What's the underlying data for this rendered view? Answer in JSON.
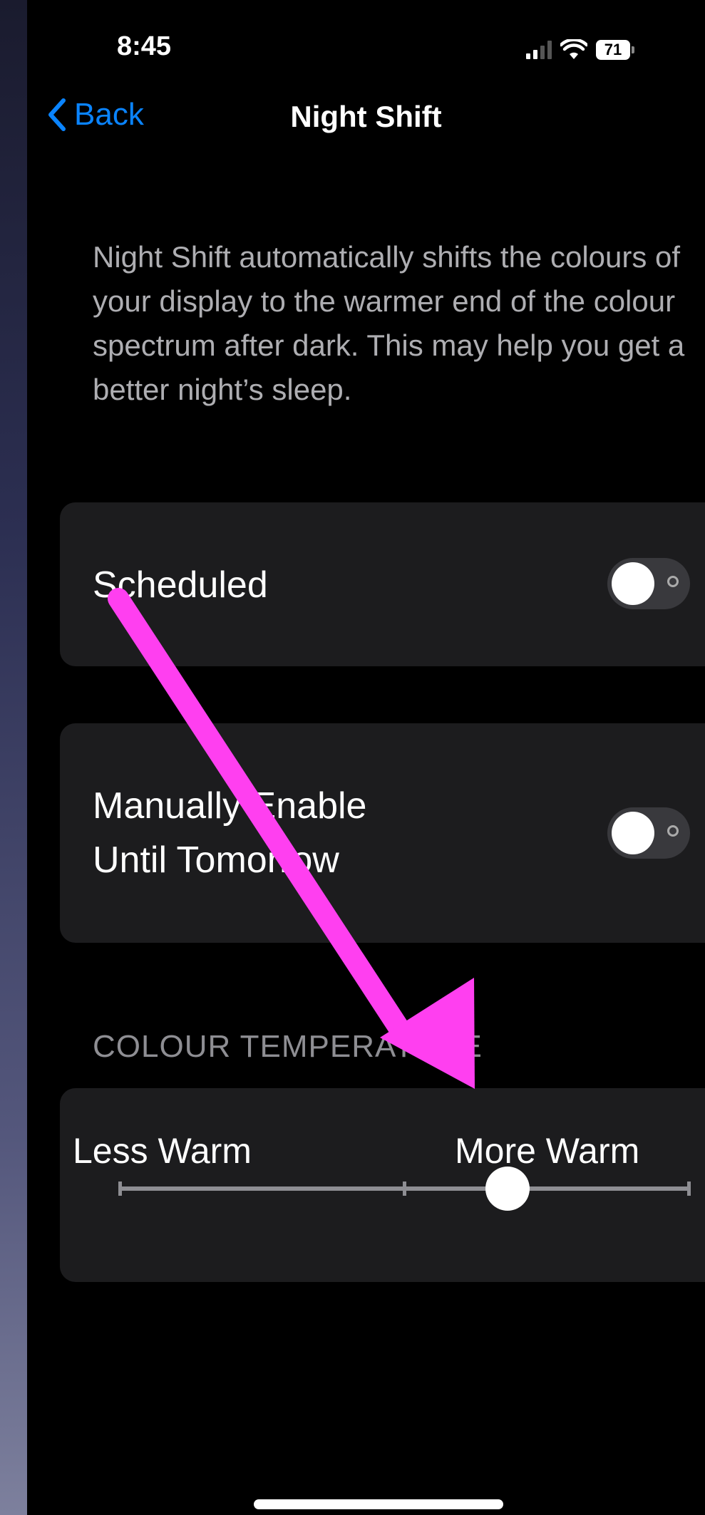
{
  "status_bar": {
    "time": "8:45",
    "battery": "71",
    "signal_icon": "cellular-signal-icon",
    "wifi_icon": "wifi-icon"
  },
  "nav": {
    "back_label": "Back",
    "title": "Night Shift"
  },
  "description": "Night Shift automatically shifts the colours of your display to the warmer end of the colour spectrum after dark. This may help you get a better night’s sleep.",
  "scheduled": {
    "label": "Scheduled",
    "enabled": false
  },
  "manual": {
    "label_line1": "Manually Enable",
    "label_line2": "Until Tomorrow",
    "enabled": false
  },
  "colour_temperature": {
    "header": "COLOUR TEMPERATURE",
    "min_label": "Less Warm",
    "max_label": "More Warm",
    "value_fraction": 0.68
  },
  "annotation": {
    "color": "#ff3ff0",
    "icon": "pointer-arrow"
  },
  "colors": {
    "accent": "#0a84ff",
    "background": "#000000",
    "card": "#1c1c1e",
    "secondary_text": "#aeaeb2"
  }
}
